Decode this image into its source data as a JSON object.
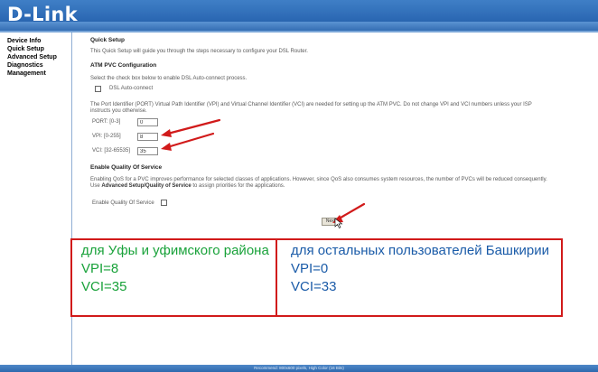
{
  "header": {
    "logo": "D-Link"
  },
  "sidebar": {
    "items": [
      {
        "label": "Device Info"
      },
      {
        "label": "Quick Setup"
      },
      {
        "label": "Advanced Setup"
      },
      {
        "label": "Diagnostics"
      },
      {
        "label": "Management"
      }
    ]
  },
  "main": {
    "title": "Quick Setup",
    "intro": "This Quick Setup will guide you through the steps necessary to configure your DSL Router.",
    "atm_heading": "ATM PVC Configuration",
    "atm_instruction": "Select the check box below to enable DSL Auto-connect process.",
    "dsl_autoconnect_label": "DSL Auto-connect",
    "pvc_help_line1": "The Port Identifier (PORT) Virtual Path Identifier (VPI) and Virtual Channel Identifier (VCI) are needed for setting up the ATM PVC. Do not change VPI and VCI numbers unless your ISP",
    "pvc_help_line2": "instructs you otherwise.",
    "port_label": "PORT: [0-3]",
    "port_value": "0",
    "vpi_label": "VPI: [0-255]",
    "vpi_value": "8",
    "vci_label": "VCI: [32-65535]",
    "vci_value": "35",
    "qos_heading": "Enable Quality Of Service",
    "qos_help_line1": "Enabling QoS for a PVC improves performance for selected classes of applications. However, since QoS also consumes system resources, the number of PVCs will be reduced consequently.",
    "qos_help_prefix": "Use",
    "qos_help_link": "Advanced Setup/Quality of Service",
    "qos_help_suffix": "to assign priorities for the applications.",
    "qos_checkbox_label": "Enable Quality Of Service",
    "next_label": "Next"
  },
  "overlay": {
    "left": {
      "line1": "для Уфы и уфимского района",
      "line2": "VPI=8",
      "line3": "VCI=35",
      "color": "#19a23a"
    },
    "right": {
      "line1": "для остальных пользователей Башкирии",
      "line2": "VPI=0",
      "line3": "VCI=33",
      "color": "#1a5ba8"
    },
    "border_color": "#d11a1a"
  },
  "footer": {
    "text": "Recommend: 800x600 pixels, High Color (16 Bits)"
  },
  "colors": {
    "header_blue": "#2d6ab5",
    "arrow_red": "#d11a1a"
  }
}
